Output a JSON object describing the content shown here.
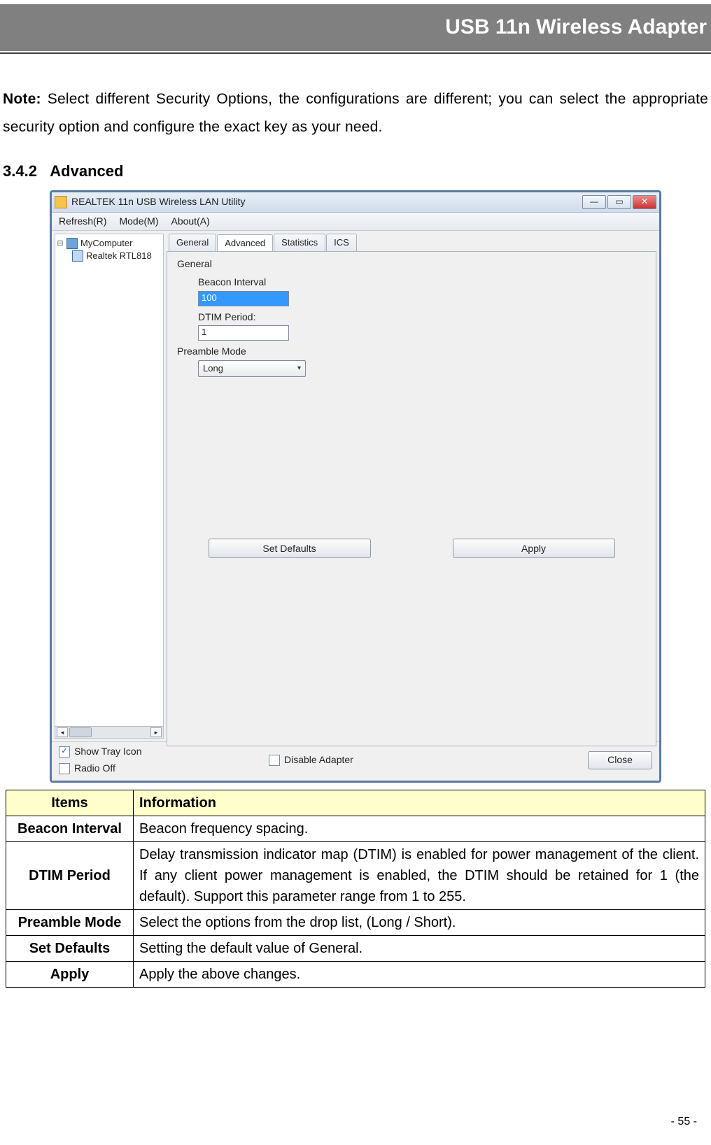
{
  "header": {
    "title": "USB 11n Wireless Adapter"
  },
  "note": {
    "label": "Note:",
    "text": " Select different Security Options, the configurations are different; you can select the appropriate security option and configure the exact key as your need."
  },
  "section": {
    "number": "3.4.2",
    "title": "Advanced"
  },
  "app": {
    "window_title": "REALTEK 11n USB Wireless LAN Utility",
    "menus": {
      "refresh": "Refresh(R)",
      "mode": "Mode(M)",
      "about": "About(A)"
    },
    "tree": {
      "root": "MyComputer",
      "child": "Realtek RTL818"
    },
    "tabs": {
      "general": "General",
      "advanced": "Advanced",
      "statistics": "Statistics",
      "ics": "ICS",
      "active": "Advanced"
    },
    "panel": {
      "group_label": "General",
      "beacon_label": "Beacon Interval",
      "beacon_value": "100",
      "dtim_label": "DTIM Period:",
      "dtim_value": "1",
      "preamble_label": "Preamble Mode",
      "preamble_value": "Long",
      "set_defaults": "Set Defaults",
      "apply": "Apply"
    },
    "bottom": {
      "show_tray": "Show Tray Icon",
      "radio_off": "Radio Off",
      "disable_adapter": "Disable Adapter",
      "close": "Close"
    }
  },
  "table": {
    "headers": {
      "items": "Items",
      "info": "Information"
    },
    "rows": [
      {
        "item": "Beacon Interval",
        "info": "Beacon frequency spacing."
      },
      {
        "item": "DTIM Period",
        "info": "Delay transmission indicator map (DTIM) is enabled for power management of the client. If any client power management is enabled, the DTIM should be retained for 1 (the default). Support this parameter range from 1 to 255.",
        "justify": true
      },
      {
        "item": "Preamble Mode",
        "info": "Select the options from the drop list, (Long / Short)."
      },
      {
        "item": "Set Defaults",
        "info": "Setting the default value of General."
      },
      {
        "item": "Apply",
        "info": "Apply the above changes."
      }
    ]
  },
  "page_number": "- 55 -"
}
